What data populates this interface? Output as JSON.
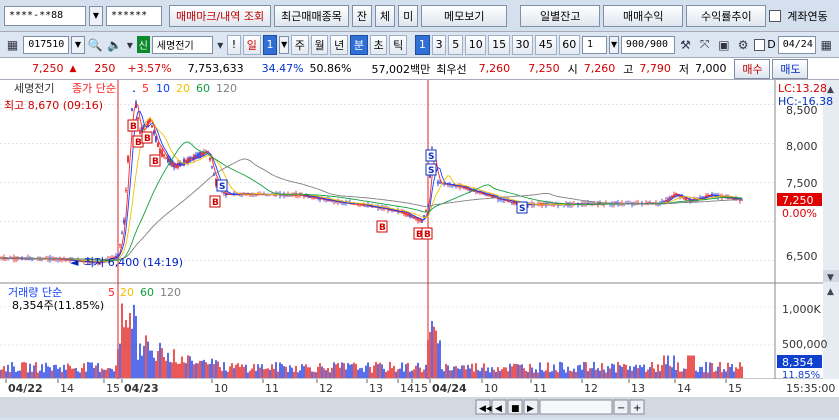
{
  "toolbar1": {
    "account_no": "****-**88",
    "password": "******",
    "tabs": [
      "매매마크/내역 조회",
      "최근매매종목",
      "잔",
      "체",
      "미",
      "메모보기",
      "일별잔고",
      "매매수익",
      "수익률추이"
    ],
    "account_link_label": "계좌연동"
  },
  "toolbar2": {
    "stock_code": "017510",
    "credit_badge": "신",
    "stock_name": "세명전기",
    "period_day": "일",
    "period_day_count": "1",
    "periods": [
      "주",
      "월",
      "년"
    ],
    "intraday": [
      "분",
      "초",
      "틱"
    ],
    "minute_options": [
      "1",
      "3",
      "5",
      "10",
      "15",
      "30",
      "45",
      "60"
    ],
    "selected_minute": "1",
    "count_value": "1",
    "bars_display": "900/900",
    "date_field": "04/24",
    "d_label": "D"
  },
  "quote": {
    "price": "7,250",
    "change": "250",
    "change_pct": "+3.57%",
    "volume": "7,753,633",
    "turnover_pct": "34.47%",
    "ratio": "50.86%",
    "amount": "57,002백만",
    "best_label": "최우선",
    "ask": "7,260",
    "bid": "7,250",
    "open_label": "시",
    "open": "7,260",
    "high_label": "고",
    "high": "7,790",
    "low_label": "저",
    "low": "7,000",
    "buy_label": "매수",
    "sell_label": "매도"
  },
  "chart": {
    "price_pane_label": "세명전기",
    "price_series_label": "종가 단순",
    "ma_periods": [
      "5",
      "10",
      "20",
      "60",
      "120"
    ],
    "ma_colors": [
      "#ff2020",
      "#1040ff",
      "#f0c000",
      "#10a040",
      "#808080"
    ],
    "high_annotation": "최고 8,670 (09:16)",
    "low_annotation": "최저 6,400 (14:19)",
    "lc_label": "LC:13.28",
    "hc_label": "HC:-16.38",
    "price_axis_ticks": [
      "8,500",
      "8,000",
      "7,500",
      "6,500"
    ],
    "current_price_tag": "7,250",
    "current_pct_tag": "0.00%",
    "volume_pane_label": "거래량 단순",
    "volume_ma_periods": [
      "5",
      "20",
      "60",
      "120"
    ],
    "volume_readout": "8,354주(11.85%)",
    "volume_axis_ticks": [
      "1,000K",
      "500,000"
    ],
    "volume_tag": "8,354",
    "volume_pct_tag": "11.85%",
    "time_axis": [
      "04/22",
      "14",
      "15",
      "04/23",
      "10",
      "11",
      "12",
      "13",
      "14",
      "15",
      "04/24",
      "10",
      "11",
      "12",
      "13",
      "14",
      "15"
    ],
    "clock": "15:35:00",
    "buy_marker": "B",
    "sell_marker": "S"
  }
}
